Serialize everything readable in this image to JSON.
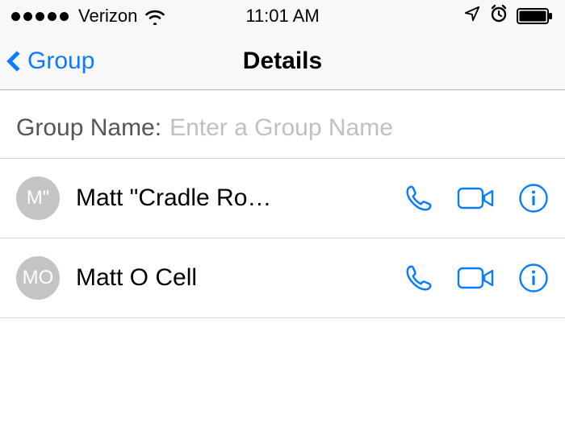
{
  "status_bar": {
    "carrier": "Verizon",
    "time": "11:01 AM"
  },
  "nav": {
    "back_label": "Group",
    "title": "Details"
  },
  "group_name": {
    "label": "Group Name:",
    "placeholder": "Enter a Group Name",
    "value": ""
  },
  "contacts": [
    {
      "initials": "M\"",
      "name": "Matt \"Cradle Ro…"
    },
    {
      "initials": "MO",
      "name": "Matt O Cell"
    }
  ],
  "colors": {
    "accent": "#0b7bff",
    "avatar_bg": "#c4c4c4"
  }
}
